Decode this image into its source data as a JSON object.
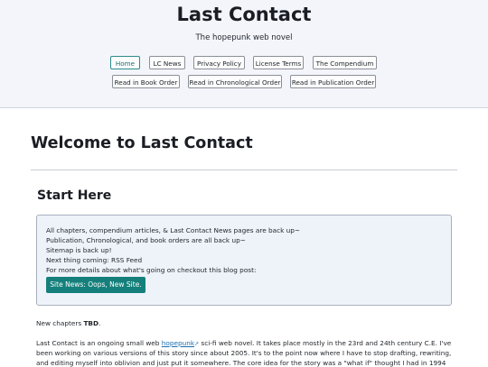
{
  "header": {
    "title": "Last Contact",
    "tagline": "The hopepunk web novel",
    "nav_row1": [
      "Home",
      "LC News",
      "Privacy Policy",
      "License Terms",
      "The Compendium"
    ],
    "nav_row2": [
      "Read in Book Order",
      "Read in Chronological Order",
      "Read in Publication Order"
    ],
    "active": "Home"
  },
  "main": {
    "title": "Welcome to Last Contact",
    "section_title": "Start Here",
    "notice": {
      "lines": [
        "All chapters, compendium articles, & Last Contact News pages are back up~",
        "Publication, Chronological, and book orders are all back up~",
        "Sitemap is back up!",
        "Next thing coming: RSS Feed",
        "For more details about what's going on checkout this blog post:"
      ],
      "button_label": "Site News: Oops, New Site."
    },
    "new_chapters_prefix": "New chapters ",
    "new_chapters_value": "TBD",
    "new_chapters_suffix": ".",
    "intro": {
      "line1_before": "Last Contact is an ongoing small web ",
      "line1_link": "hopepunk",
      "line1_after": " sci-fi web novel. It takes place mostly in the 23rd and 24th century C.E. I've",
      "line2": "been working on various versions of this story since about 2005. It's to the point now where I have to stop drafting, rewriting,",
      "line3": "and editing myself into oblivion and just put it somewhere. The core idea for the story was a \"what if\" thought I had in 1994"
    }
  },
  "colors": {
    "header_bg": "#f3f5fb",
    "accent": "#15807b",
    "link": "#1a6fb0",
    "notice_bg": "#eef3fa"
  }
}
